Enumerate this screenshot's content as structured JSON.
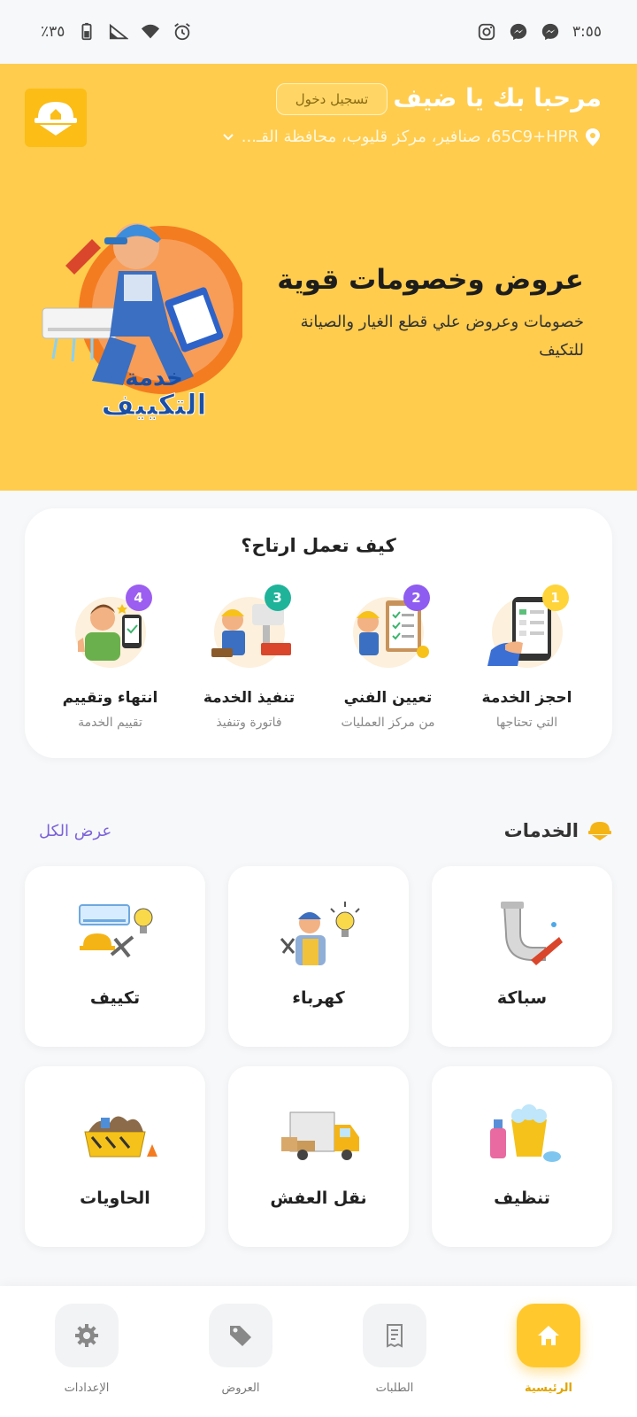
{
  "status_bar": {
    "time": "٣:٥٥",
    "battery": "٪٣٥",
    "icons_right": [
      "messenger-icon",
      "messenger-icon",
      "instagram-icon"
    ],
    "icons_left": [
      "alarm-icon",
      "wifi-icon",
      "signal-icon",
      "battery-icon"
    ]
  },
  "header": {
    "greeting": "مرحبا بك يا ضيف",
    "wave_emoji": "👋",
    "login_label": "تسجيل دخول",
    "location": "65C9+HPR، صنافير، مركز قليوب، محافظة القـ...",
    "promo_title": "عروض وخصومات قوية",
    "promo_subtitle": "خصومات وعروض علي قطع الغيار والصيانة للتكيف",
    "hero_text_line1": "خدمة",
    "hero_text_line2": "التكييف",
    "bg_color": "#ffcc4d"
  },
  "how_it_works": {
    "title": "كيف تعمل ارتاح؟",
    "steps": [
      {
        "number": "1",
        "title": "احجز الخدمة",
        "desc": "التي تحتاجها",
        "badge_color": "#ffd43b"
      },
      {
        "number": "2",
        "title": "تعيين الفني",
        "desc": "من مركز العمليات",
        "badge_color": "#8e5cf0"
      },
      {
        "number": "3",
        "title": "تنفيذ الخدمة",
        "desc": "فاتورة وتنفيذ",
        "badge_color": "#1fb39a"
      },
      {
        "number": "4",
        "title": "انتهاء وتقييم",
        "desc": "تقييم الخدمة",
        "badge_color": "#9b5ef0"
      }
    ]
  },
  "services": {
    "title": "الخدمات",
    "view_all": "عرض الكل",
    "items": [
      {
        "label": "سباكة",
        "icon": "plumbing-icon"
      },
      {
        "label": "كهرباء",
        "icon": "electrician-icon"
      },
      {
        "label": "تكييف",
        "icon": "ac-icon"
      },
      {
        "label": "تنظيف",
        "icon": "cleaning-icon"
      },
      {
        "label": "نقل العفش",
        "icon": "moving-truck-icon"
      },
      {
        "label": "الحاويات",
        "icon": "dumpster-icon"
      }
    ]
  },
  "bottom_nav": {
    "items": [
      {
        "label": "الرئيسية",
        "icon": "home-icon",
        "active": true
      },
      {
        "label": "الطلبات",
        "icon": "orders-icon",
        "active": false
      },
      {
        "label": "العروض",
        "icon": "tag-icon",
        "active": false
      },
      {
        "label": "الإعدادات",
        "icon": "gear-icon",
        "active": false
      }
    ],
    "accent": "#ffc92e"
  }
}
